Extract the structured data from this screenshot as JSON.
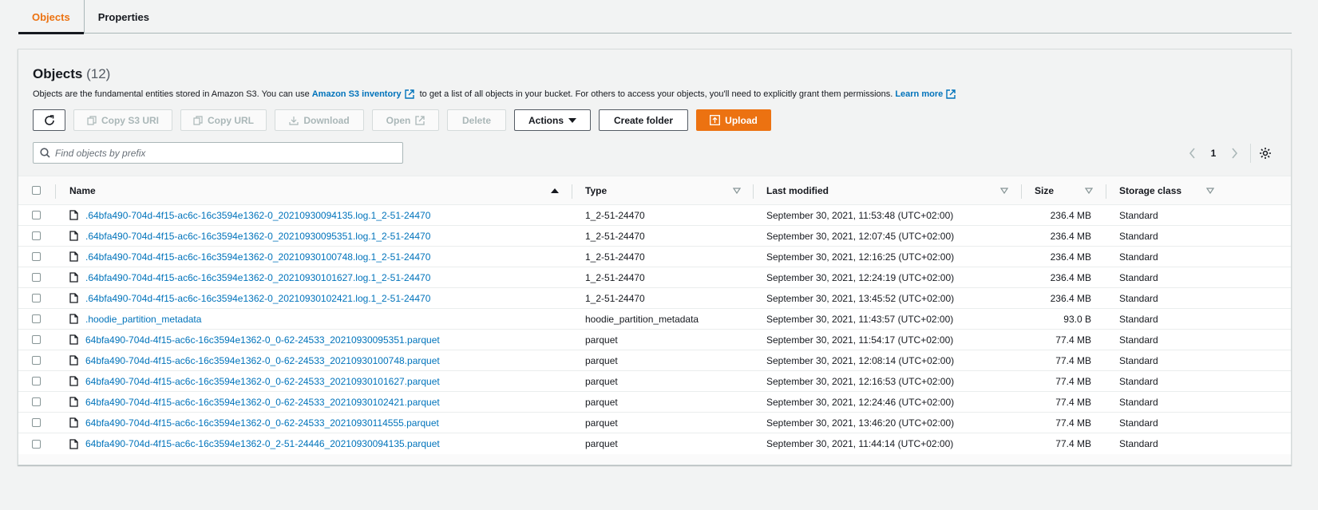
{
  "tabs": [
    {
      "label": "Objects",
      "active": true
    },
    {
      "label": "Properties",
      "active": false
    }
  ],
  "panel": {
    "title": "Objects",
    "count": "(12)",
    "description_before": "Objects are the fundamental entities stored in Amazon S3. You can use",
    "inventory_link": "Amazon S3 inventory",
    "description_after": "to get a list of all objects in your bucket. For others to access your objects, you'll need to explicitly grant them permissions.",
    "learn_more": "Learn more"
  },
  "toolbar": {
    "refresh_icon": "refresh-icon",
    "copy_s3_uri": "Copy S3 URI",
    "copy_url": "Copy URL",
    "download": "Download",
    "open": "Open",
    "delete": "Delete",
    "actions": "Actions",
    "create_folder": "Create folder",
    "upload": "Upload"
  },
  "search": {
    "placeholder": "Find objects by prefix",
    "value": ""
  },
  "pagination": {
    "current_page": "1"
  },
  "columns": {
    "name": "Name",
    "type": "Type",
    "last_modified": "Last modified",
    "size": "Size",
    "storage_class": "Storage class"
  },
  "colors": {
    "accent": "#ec7211",
    "link": "#0073bb"
  },
  "rows": [
    {
      "name": ".64bfa490-704d-4f15-ac6c-16c3594e1362-0_20210930094135.log.1_2-51-24470",
      "type": "1_2-51-24470",
      "modified": "September 30, 2021, 11:53:48 (UTC+02:00)",
      "size": "236.4 MB",
      "storage": "Standard"
    },
    {
      "name": ".64bfa490-704d-4f15-ac6c-16c3594e1362-0_20210930095351.log.1_2-51-24470",
      "type": "1_2-51-24470",
      "modified": "September 30, 2021, 12:07:45 (UTC+02:00)",
      "size": "236.4 MB",
      "storage": "Standard"
    },
    {
      "name": ".64bfa490-704d-4f15-ac6c-16c3594e1362-0_20210930100748.log.1_2-51-24470",
      "type": "1_2-51-24470",
      "modified": "September 30, 2021, 12:16:25 (UTC+02:00)",
      "size": "236.4 MB",
      "storage": "Standard"
    },
    {
      "name": ".64bfa490-704d-4f15-ac6c-16c3594e1362-0_20210930101627.log.1_2-51-24470",
      "type": "1_2-51-24470",
      "modified": "September 30, 2021, 12:24:19 (UTC+02:00)",
      "size": "236.4 MB",
      "storage": "Standard"
    },
    {
      "name": ".64bfa490-704d-4f15-ac6c-16c3594e1362-0_20210930102421.log.1_2-51-24470",
      "type": "1_2-51-24470",
      "modified": "September 30, 2021, 13:45:52 (UTC+02:00)",
      "size": "236.4 MB",
      "storage": "Standard"
    },
    {
      "name": ".hoodie_partition_metadata",
      "type": "hoodie_partition_metadata",
      "modified": "September 30, 2021, 11:43:57 (UTC+02:00)",
      "size": "93.0 B",
      "storage": "Standard"
    },
    {
      "name": "64bfa490-704d-4f15-ac6c-16c3594e1362-0_0-62-24533_20210930095351.parquet",
      "type": "parquet",
      "modified": "September 30, 2021, 11:54:17 (UTC+02:00)",
      "size": "77.4 MB",
      "storage": "Standard"
    },
    {
      "name": "64bfa490-704d-4f15-ac6c-16c3594e1362-0_0-62-24533_20210930100748.parquet",
      "type": "parquet",
      "modified": "September 30, 2021, 12:08:14 (UTC+02:00)",
      "size": "77.4 MB",
      "storage": "Standard"
    },
    {
      "name": "64bfa490-704d-4f15-ac6c-16c3594e1362-0_0-62-24533_20210930101627.parquet",
      "type": "parquet",
      "modified": "September 30, 2021, 12:16:53 (UTC+02:00)",
      "size": "77.4 MB",
      "storage": "Standard"
    },
    {
      "name": "64bfa490-704d-4f15-ac6c-16c3594e1362-0_0-62-24533_20210930102421.parquet",
      "type": "parquet",
      "modified": "September 30, 2021, 12:24:46 (UTC+02:00)",
      "size": "77.4 MB",
      "storage": "Standard"
    },
    {
      "name": "64bfa490-704d-4f15-ac6c-16c3594e1362-0_0-62-24533_20210930114555.parquet",
      "type": "parquet",
      "modified": "September 30, 2021, 13:46:20 (UTC+02:00)",
      "size": "77.4 MB",
      "storage": "Standard"
    },
    {
      "name": "64bfa490-704d-4f15-ac6c-16c3594e1362-0_2-51-24446_20210930094135.parquet",
      "type": "parquet",
      "modified": "September 30, 2021, 11:44:14 (UTC+02:00)",
      "size": "77.4 MB",
      "storage": "Standard"
    }
  ]
}
